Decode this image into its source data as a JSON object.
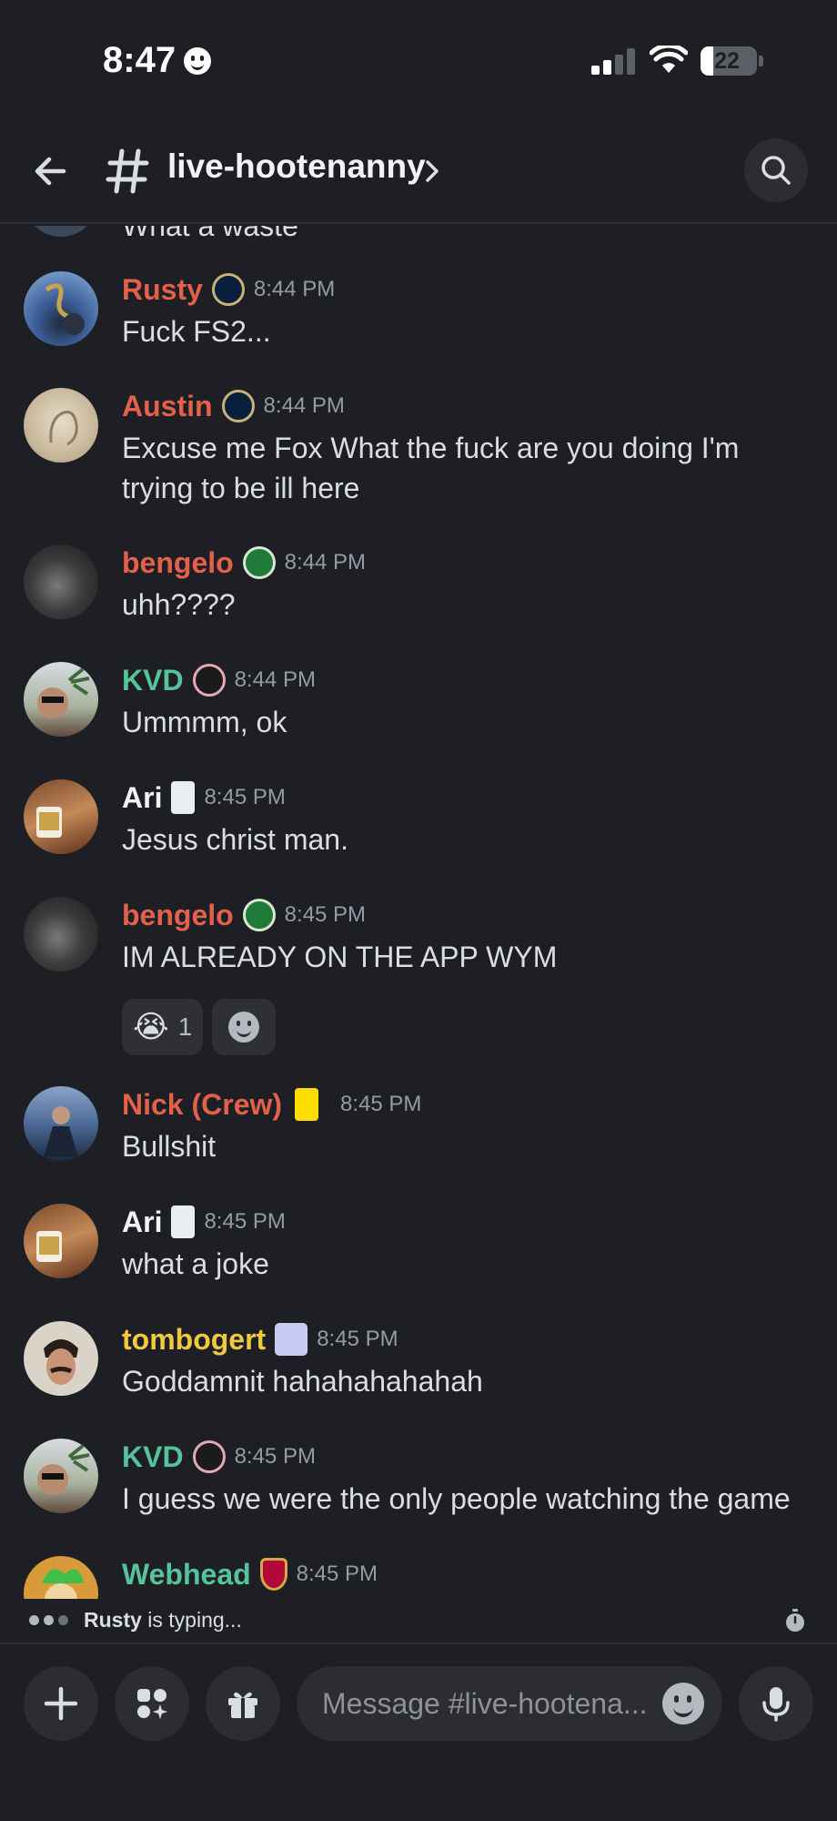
{
  "status_bar": {
    "time": "8:47",
    "battery_level": "22"
  },
  "header": {
    "channel_name": "live-hootenanny",
    "icons": [
      "back-arrow-icon",
      "hash-icon",
      "chevron-right-icon",
      "search-icon"
    ]
  },
  "previous_message_clipped": "What a waste",
  "messages": [
    {
      "username": "Rusty",
      "name_color": "#e3604a",
      "badge": "philadelphia-union-badge",
      "time": "8:44 PM",
      "text": "Fuck FS2..."
    },
    {
      "username": "Austin",
      "name_color": "#e3604a",
      "badge": "philadelphia-union-badge",
      "time": "8:44 PM",
      "text": "Excuse me Fox What the fuck are you doing I'm trying to be ill here"
    },
    {
      "username": "bengelo",
      "name_color": "#e3604a",
      "badge": "portland-timbers-badge",
      "time": "8:44 PM",
      "text": "uhh????"
    },
    {
      "username": "KVD",
      "name_color": "#56c49a",
      "badge": "inter-miami-badge",
      "time": "8:44 PM",
      "text": "Ummmm, ok"
    },
    {
      "username": "Ari",
      "name_color": "#f2f3f5",
      "badge": "minnesota-united-badge",
      "time": "8:45 PM",
      "text": "Jesus christ man."
    },
    {
      "username": "bengelo",
      "name_color": "#e3604a",
      "badge": "portland-timbers-badge",
      "time": "8:45 PM",
      "text": "IM ALREADY ON THE APP WYM",
      "reactions": [
        {
          "emoji": "😭",
          "count": "1"
        }
      ]
    },
    {
      "username": "Nick (Crew)",
      "name_color": "#e3604a",
      "badge": "columbus-crew-badge",
      "time": "8:45 PM",
      "text": "Bullshit"
    },
    {
      "username": "Ari",
      "name_color": "#f2f3f5",
      "badge": "minnesota-united-badge",
      "time": "8:45 PM",
      "text": "what a joke"
    },
    {
      "username": "tombogert",
      "name_color": "#f0c93d",
      "badge": "mustache-badge",
      "time": "8:45 PM",
      "text": "Goddamnit hahahahahahah"
    },
    {
      "username": "KVD",
      "name_color": "#56c49a",
      "badge": "inter-miami-badge",
      "time": "8:45 PM",
      "text": "I guess we were the only people watching the game"
    },
    {
      "username": "Webhead",
      "name_color": "#56c49a",
      "badge": "real-salt-lake-badge",
      "time": "8:45 PM",
      "text": ""
    }
  ],
  "typing": {
    "user": "Rusty",
    "suffix": " is typing..."
  },
  "composer": {
    "placeholder": "Message #live-hootena...",
    "icons": [
      "plus-icon",
      "apps-icon",
      "gift-icon",
      "emoji-icon",
      "microphone-icon"
    ]
  }
}
